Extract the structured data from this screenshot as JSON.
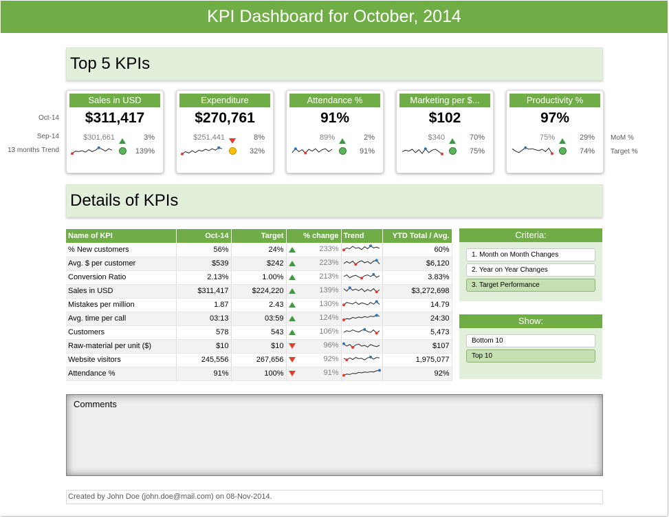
{
  "title": "KPI Dashboard for October, 2014",
  "top_section": {
    "title": "Top 5 KPIs"
  },
  "row_labels": {
    "current": "Oct-14",
    "previous": "Sep-14",
    "trend": "13 months Trend"
  },
  "right_labels": {
    "mom": "MoM %",
    "target": "Target %"
  },
  "kpis": [
    {
      "name": "Sales in USD",
      "value": "$311,417",
      "previous": "$301,661",
      "mom_pct": "3%",
      "mom_dir": "up",
      "target_pct": "139%",
      "target_status": "green"
    },
    {
      "name": "Expenditure",
      "value": "$270,761",
      "previous": "$251,441",
      "mom_pct": "8%",
      "mom_dir": "down",
      "target_pct": "32%",
      "target_status": "yellow"
    },
    {
      "name": "Attendance %",
      "value": "91%",
      "previous": "89%",
      "mom_pct": "2%",
      "mom_dir": "up",
      "target_pct": "91%",
      "target_status": "green"
    },
    {
      "name": "Marketing per $...",
      "value": "$102",
      "previous": "$340",
      "mom_pct": "70%",
      "mom_dir": "up",
      "target_pct": "75%",
      "target_status": "green"
    },
    {
      "name": "Productivity %",
      "value": "97%",
      "previous": "75%",
      "mom_pct": "29%",
      "mom_dir": "up",
      "target_pct": "74%",
      "target_status": "green"
    }
  ],
  "details_section": {
    "title": "Details of KPIs"
  },
  "table": {
    "headers": [
      "Name of KPI",
      "Oct-14",
      "Target",
      "% change",
      "Trend",
      "YTD Total / Avg."
    ],
    "rows": [
      {
        "name": "% New customers",
        "oct": "56%",
        "target": "24%",
        "dir": "up",
        "change": "233%",
        "ytd": "60%"
      },
      {
        "name": "Avg. $ per customer",
        "oct": "$539",
        "target": "$242",
        "dir": "up",
        "change": "223%",
        "ytd": "$6,120"
      },
      {
        "name": "Conversion Ratio",
        "oct": "2.13%",
        "target": "1.00%",
        "dir": "up",
        "change": "213%",
        "ytd": "3.83%"
      },
      {
        "name": "Sales in USD",
        "oct": "$311,417",
        "target": "$224,220",
        "dir": "up",
        "change": "139%",
        "ytd": "$3,272,698"
      },
      {
        "name": "Mistakes per million",
        "oct": "1.87",
        "target": "2.43",
        "dir": "up",
        "change": "130%",
        "ytd": "14.79"
      },
      {
        "name": "Avg. time per call",
        "oct": "03:13",
        "target": "03:59",
        "dir": "up",
        "change": "124%",
        "ytd": "24:30"
      },
      {
        "name": "Customers",
        "oct": "578",
        "target": "543",
        "dir": "up",
        "change": "106%",
        "ytd": "5,473"
      },
      {
        "name": "Raw-material per unit ($)",
        "oct": "$10",
        "target": "$10",
        "dir": "down",
        "change": "96%",
        "ytd": "$107"
      },
      {
        "name": "Website visitors",
        "oct": "245,556",
        "target": "267,656",
        "dir": "down",
        "change": "92%",
        "ytd": "1,975,077"
      },
      {
        "name": "Attendance %",
        "oct": "91%",
        "target": "100%",
        "dir": "down",
        "change": "91%",
        "ytd": "92%"
      }
    ]
  },
  "criteria": {
    "title": "Criteria:",
    "options": [
      "1. Month on Month Changes",
      "2. Year on Year Changes",
      "3. Target Performance"
    ],
    "selected_index": 2
  },
  "show": {
    "title": "Show:",
    "options": [
      "Bottom 10",
      "Top 10"
    ],
    "selected_index": 1
  },
  "comments": {
    "label": "Comments"
  },
  "footer": {
    "text": "Created by John Doe (john.doe@mail.com) on 08-Nov-2014."
  },
  "colors": {
    "accent": "#70ad47",
    "light_green": "#e2efda",
    "up": "#3f9a3f",
    "down": "#e03c31",
    "status_green": "#5bb55b",
    "status_yellow": "#ffc000"
  }
}
